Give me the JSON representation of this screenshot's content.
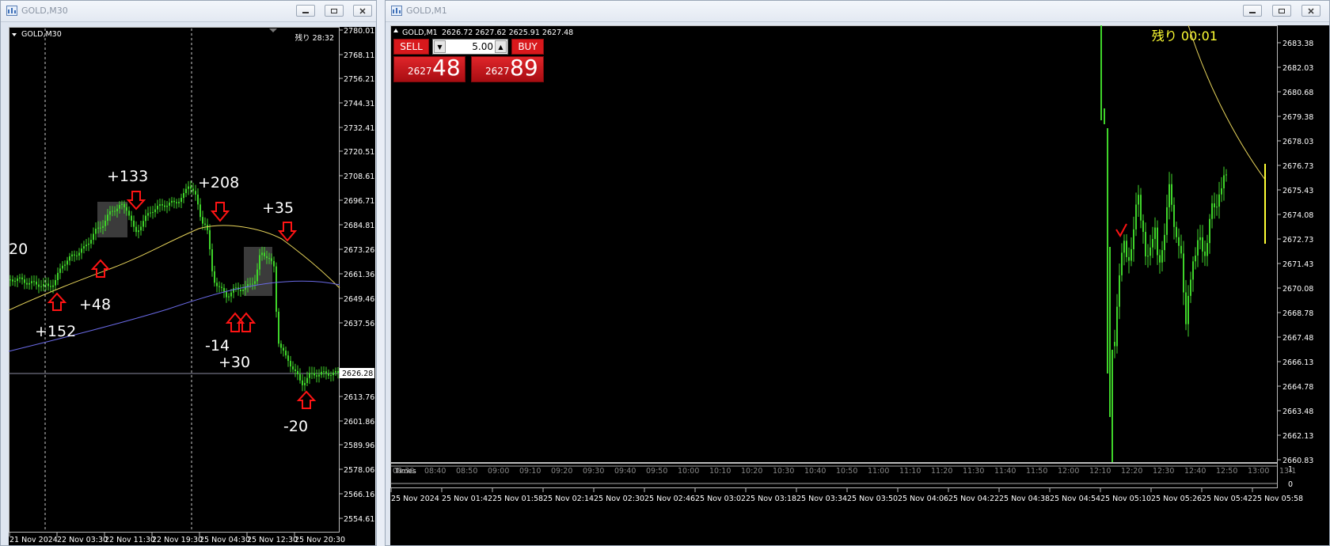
{
  "left_window": {
    "title": "GOLD,M30",
    "chart_label": "GOLD,M30",
    "remaining": "残り 28:32",
    "price_ticks": [
      "2780.01",
      "2768.11",
      "2756.21",
      "2744.31",
      "2732.41",
      "2720.51",
      "2708.61",
      "2696.71",
      "2684.81",
      "2673.26",
      "2661.36",
      "2649.46",
      "2637.56",
      "2626.28",
      "2613.76",
      "2601.86",
      "2589.96",
      "2578.06",
      "2566.16",
      "2554.61"
    ],
    "current_price": "2626.28",
    "time_labels": [
      "21 Nov 2024",
      "22 Nov 03:30",
      "22 Nov 11:30",
      "22 Nov 19:30",
      "25 Nov 04:30",
      "25 Nov 12:30",
      "25 Nov 20:30"
    ],
    "annotations": [
      "20",
      "+133",
      "+208",
      "+35",
      "+48",
      "+152",
      "-14",
      "+30",
      "-20"
    ]
  },
  "right_window": {
    "title": "GOLD,M1",
    "chart_label": "GOLD,M1",
    "ohlc": "2626.72 2627.62 2625.91 2627.48",
    "remaining": "残り 00:01",
    "trade_panel": {
      "sell_label": "SELL",
      "buy_label": "BUY",
      "lot": "5.00",
      "bid_small": "2627",
      "bid_big": "48",
      "ask_small": "2627",
      "ask_big": "89"
    },
    "price_ticks": [
      "2683.38",
      "2682.03",
      "2680.68",
      "2679.38",
      "2678.03",
      "2676.73",
      "2675.43",
      "2674.08",
      "2672.73",
      "2671.43",
      "2670.08",
      "2668.78",
      "2667.48",
      "2666.13",
      "2664.78",
      "2663.48",
      "2662.13",
      "2660.83"
    ],
    "indicator_label": "Times",
    "indicator_ticks": [
      "08:30",
      "08:40",
      "08:50",
      "09:00",
      "09:10",
      "09:20",
      "09:30",
      "09:40",
      "09:50",
      "10:00",
      "10:10",
      "10:20",
      "10:30",
      "10:40",
      "10:50",
      "11:00",
      "11:10",
      "11:20",
      "11:30",
      "11:40",
      "11:50",
      "12:00",
      "12:10",
      "12:20",
      "12:30",
      "12:40",
      "12:50",
      "13:00",
      "13:1"
    ],
    "indicator_scale": [
      "1",
      "0"
    ],
    "time_labels": [
      "25 Nov 2024",
      "25 Nov 01:42",
      "25 Nov 01:58",
      "25 Nov 02:14",
      "25 Nov 02:30",
      "25 Nov 02:46",
      "25 Nov 03:02",
      "25 Nov 03:18",
      "25 Nov 03:34",
      "25 Nov 03:50",
      "25 Nov 04:06",
      "25 Nov 04:22",
      "25 Nov 04:38",
      "25 Nov 04:54",
      "25 Nov 05:10",
      "25 Nov 05:26",
      "25 Nov 05:42",
      "25 Nov 05:58"
    ]
  },
  "colors": {
    "candle": "#3fd42a",
    "ma_fast": "#e6d35a",
    "ma_slow": "#6a6ae6",
    "arrow": "#ff1414",
    "remaining_right": "#ffff33",
    "sell_buy": "#d8181c"
  }
}
